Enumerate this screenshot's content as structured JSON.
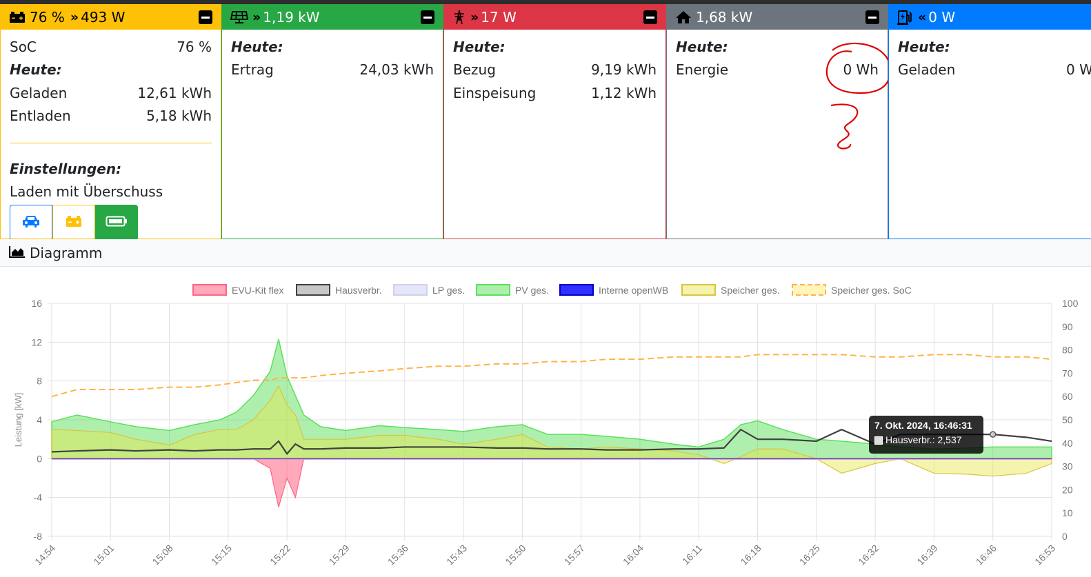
{
  "battery": {
    "header_soc": "76 %",
    "header_power": "493 W",
    "soc_label": "SoC",
    "soc_value": "76 %",
    "today_label": "Heute:",
    "charged_label": "Geladen",
    "charged_value": "12,61 kWh",
    "discharged_label": "Entladen",
    "discharged_value": "5,18 kWh",
    "settings_label": "Einstellungen:",
    "mode_label": "Laden mit Überschuss"
  },
  "pv": {
    "header_power": "1,19 kW",
    "today_label": "Heute:",
    "yield_label": "Ertrag",
    "yield_value": "24,03 kWh"
  },
  "grid": {
    "header_power": "17 W",
    "today_label": "Heute:",
    "import_label": "Bezug",
    "import_value": "9,19 kWh",
    "export_label": "Einspeisung",
    "export_value": "1,12 kWh"
  },
  "house": {
    "header_power": "1,68 kW",
    "today_label": "Heute:",
    "energy_label": "Energie",
    "energy_value": "0 Wh"
  },
  "charge": {
    "header_power": "0 W",
    "today_label": "Heute:",
    "charged_label": "Geladen",
    "charged_value": "0 W"
  },
  "diagram": {
    "title": "Diagramm"
  },
  "tooltip": {
    "title": "7. Okt. 2024, 16:46:31",
    "label": "Hausverbr.: 2,537"
  },
  "colors": {
    "battery": "#ffc107",
    "pv": "#28a745",
    "grid": "#dc3545",
    "house": "#6c757d",
    "charge": "#007bff"
  },
  "chart_data": {
    "type": "area",
    "ylabel": "Leistung [kW]",
    "ylim": [
      -8,
      16
    ],
    "y_ticks": [
      -8,
      -4,
      0,
      4,
      8,
      12,
      16
    ],
    "y2lim": [
      0,
      100
    ],
    "y2_ticks": [
      0,
      10,
      20,
      30,
      40,
      50,
      60,
      70,
      80,
      90,
      100
    ],
    "x_ticks": [
      "14:54",
      "15:01",
      "15:08",
      "15:15",
      "15:22",
      "15:29",
      "15:36",
      "15:43",
      "15:50",
      "15:57",
      "16:04",
      "16:11",
      "16:18",
      "16:25",
      "16:32",
      "16:39",
      "16:46",
      "16:53"
    ],
    "grid": true,
    "legend_position": "top",
    "x": [
      "14:54",
      "14:57",
      "15:01",
      "15:04",
      "15:08",
      "15:11",
      "15:14",
      "15:16",
      "15:18",
      "15:20",
      "15:21",
      "15:22",
      "15:23",
      "15:24",
      "15:26",
      "15:29",
      "15:33",
      "15:36",
      "15:40",
      "15:43",
      "15:47",
      "15:50",
      "15:53",
      "15:57",
      "16:00",
      "16:04",
      "16:08",
      "16:11",
      "16:14",
      "16:16",
      "16:18",
      "16:21",
      "16:25",
      "16:28",
      "16:32",
      "16:35",
      "16:39",
      "16:43",
      "16:46",
      "16:50",
      "16:53"
    ],
    "series": [
      {
        "name": "EVU-Kit flex",
        "color": "#ff6384",
        "values": [
          0,
          0,
          0,
          0,
          0,
          0,
          0,
          0,
          0,
          -1,
          -5,
          -2,
          -4,
          0,
          0,
          0,
          0,
          0,
          0,
          0,
          0,
          0,
          0,
          0,
          0,
          0,
          0,
          0,
          0,
          0,
          0,
          0,
          0,
          0,
          0,
          0,
          0,
          0,
          0,
          0,
          0
        ]
      },
      {
        "name": "Hausverbr.",
        "color": "#404040",
        "values": [
          0.7,
          0.8,
          0.9,
          0.8,
          0.9,
          0.8,
          0.9,
          0.9,
          1.0,
          1.0,
          1.8,
          0.5,
          1.5,
          1.0,
          1.0,
          1.1,
          1.1,
          1.2,
          1.2,
          1.2,
          1.1,
          1.1,
          1.0,
          1.0,
          0.9,
          0.9,
          1.0,
          1.0,
          1.1,
          3.0,
          2.0,
          2.0,
          1.8,
          3.0,
          1.5,
          2.5,
          2.5,
          2.5,
          2.5,
          2.2,
          1.8
        ]
      },
      {
        "name": "LP ges.",
        "color": "#c8c8f0",
        "values": [
          0,
          0,
          0,
          0,
          0,
          0,
          0,
          0,
          0,
          0,
          0,
          0,
          0,
          0,
          0,
          0,
          0,
          0,
          0,
          0,
          0,
          0,
          0,
          0,
          0,
          0,
          0,
          0,
          0,
          0,
          0,
          0,
          0,
          0,
          0,
          0,
          0,
          0,
          0,
          0,
          0
        ]
      },
      {
        "name": "PV ges.",
        "color": "#4cdc4c",
        "values": [
          3.8,
          4.5,
          3.8,
          3.3,
          2.9,
          3.5,
          4.0,
          4.8,
          6.5,
          9.0,
          12.3,
          8.5,
          6.5,
          4.5,
          3.3,
          2.9,
          3.4,
          3.2,
          3.0,
          2.8,
          3.3,
          3.5,
          2.5,
          2.5,
          2.3,
          2.0,
          1.5,
          1.2,
          2.0,
          3.5,
          3.9,
          3.0,
          2.0,
          1.8,
          1.5,
          1.2,
          1.0,
          1.1,
          1.2,
          1.2,
          1.2
        ]
      },
      {
        "name": "Interne openWB",
        "color": "#0000ff",
        "values": [
          0,
          0,
          0,
          0,
          0,
          0,
          0,
          0,
          0,
          0,
          0,
          0,
          0,
          0,
          0,
          0,
          0,
          0,
          0,
          0,
          0,
          0,
          0,
          0,
          0,
          0,
          0,
          0,
          0,
          0,
          0,
          0,
          0,
          0,
          0,
          0,
          0,
          0,
          0,
          0,
          0
        ]
      },
      {
        "name": "Speicher ges.",
        "color": "#e6e64c",
        "values": [
          3.0,
          2.9,
          2.7,
          2.0,
          1.4,
          2.5,
          3.0,
          3.0,
          4.0,
          6.0,
          7.5,
          5.5,
          4.5,
          2.0,
          2.0,
          2.0,
          2.4,
          2.4,
          2.0,
          1.5,
          2.0,
          2.5,
          1.2,
          1.0,
          1.2,
          1.0,
          0.8,
          0.4,
          -0.5,
          0.2,
          1.0,
          1.0,
          0,
          -1.5,
          -0.5,
          0,
          -1.5,
          -1.6,
          -1.8,
          -1.5,
          -0.5
        ]
      },
      {
        "name": "Speicher ges. SoC",
        "color": "#ffa500",
        "axis": "right",
        "values": [
          60,
          63,
          63,
          63,
          64,
          64,
          65,
          66,
          67,
          67,
          68,
          68,
          68,
          68,
          69,
          70,
          71,
          72,
          73,
          73,
          74,
          74,
          75,
          75,
          76,
          76,
          77,
          77,
          77,
          77,
          78,
          78,
          78,
          78,
          77,
          77,
          78,
          78,
          77,
          77,
          76
        ]
      }
    ]
  }
}
